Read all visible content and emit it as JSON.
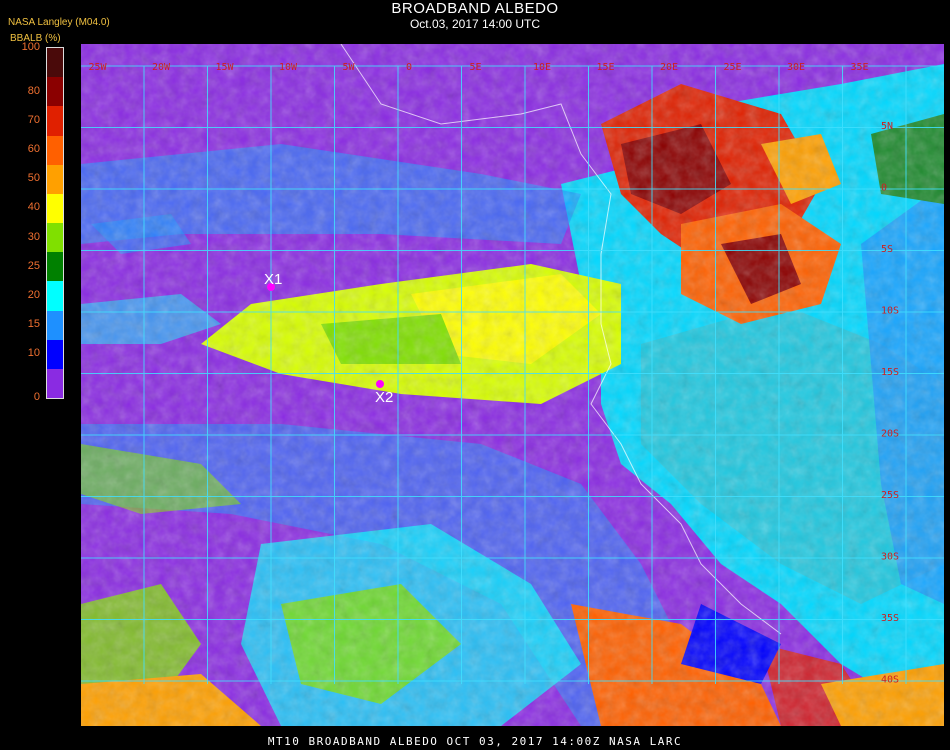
{
  "header": {
    "title": "BROADBAND ALBEDO",
    "datetime": "Oct.03, 2017 14:00 UTC",
    "producer": "NASA Langley (M04.0)"
  },
  "colorbar": {
    "label": "BBALB (%)",
    "ticks": [
      "100",
      "80",
      "70",
      "60",
      "50",
      "40",
      "30",
      "25",
      "20",
      "15",
      "10",
      "0"
    ],
    "colors": [
      "#4a0a0a",
      "#8b0000",
      "#e02000",
      "#ff6000",
      "#ffa000",
      "#ffff00",
      "#80e000",
      "#008000",
      "#00ffff",
      "#1e90ff",
      "#0000ff",
      "#8a2be2"
    ]
  },
  "map": {
    "markers": [
      {
        "label": "X1"
      },
      {
        "label": "X2"
      }
    ],
    "lon_labels": [
      "25W",
      "20W",
      "15W",
      "10W",
      "5W",
      "0",
      "5E",
      "10E",
      "15E",
      "20E",
      "25E",
      "30E",
      "35E"
    ],
    "lat_labels": [
      "5N",
      "0",
      "5S",
      "10S",
      "15S",
      "20S",
      "25S",
      "30S",
      "35S",
      "40S"
    ]
  },
  "footer": {
    "text": "MT10  BROADBAND ALBEDO   OCT 03, 2017 14:00Z   NASA LARC"
  }
}
